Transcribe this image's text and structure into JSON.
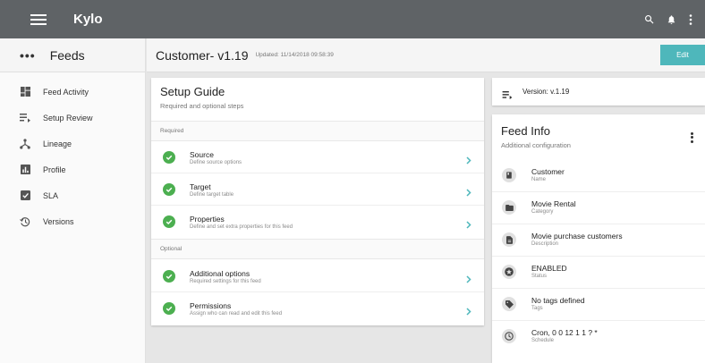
{
  "app": {
    "brand": "Kylo"
  },
  "sidebar": {
    "title": "Feeds",
    "items": [
      {
        "label": "Feed Activity",
        "icon": "dashboard-icon"
      },
      {
        "label": "Setup Review",
        "icon": "playlist-icon"
      },
      {
        "label": "Lineage",
        "icon": "lineage-icon"
      },
      {
        "label": "Profile",
        "icon": "chart-icon"
      },
      {
        "label": "SLA",
        "icon": "verified-icon"
      },
      {
        "label": "Versions",
        "icon": "history-icon"
      }
    ]
  },
  "header": {
    "feed_name": "Customer- v1.19",
    "updated": "Updated: 11/14/2018 09:58:39",
    "edit_label": "Edit"
  },
  "setup_guide": {
    "title": "Setup Guide",
    "subtitle": "Required and optional steps",
    "required_label": "Required",
    "optional_label": "Optional",
    "required_steps": [
      {
        "title": "Source",
        "desc": "Define source options"
      },
      {
        "title": "Target",
        "desc": "Define target table"
      },
      {
        "title": "Properties",
        "desc": "Define and set extra properties for this feed"
      }
    ],
    "optional_steps": [
      {
        "title": "Additional options",
        "desc": "Required settings for this feed"
      },
      {
        "title": "Permissions",
        "desc": "Assign who can read and edit this feed"
      }
    ]
  },
  "version_card": {
    "text": "Version: v.1.19"
  },
  "feed_info": {
    "title": "Feed Info",
    "subtitle": "Additional configuration",
    "rows": [
      {
        "value": "Customer",
        "label": "Name",
        "icon": "book-icon"
      },
      {
        "value": "Movie Rental",
        "label": "Category",
        "icon": "folder-icon"
      },
      {
        "value": "Movie purchase customers",
        "label": "Description",
        "icon": "description-icon"
      },
      {
        "value": "ENABLED",
        "label": "Status",
        "icon": "stars-icon"
      },
      {
        "value": "No tags defined",
        "label": "Tags",
        "icon": "tag-icon"
      },
      {
        "value": "Cron, 0 0 12 1 1 ? *",
        "label": "Schedule",
        "icon": "clock-icon"
      }
    ]
  },
  "colors": {
    "topbar": "#5f6366",
    "accent": "#4eb7bb",
    "check": "#4caf50"
  }
}
